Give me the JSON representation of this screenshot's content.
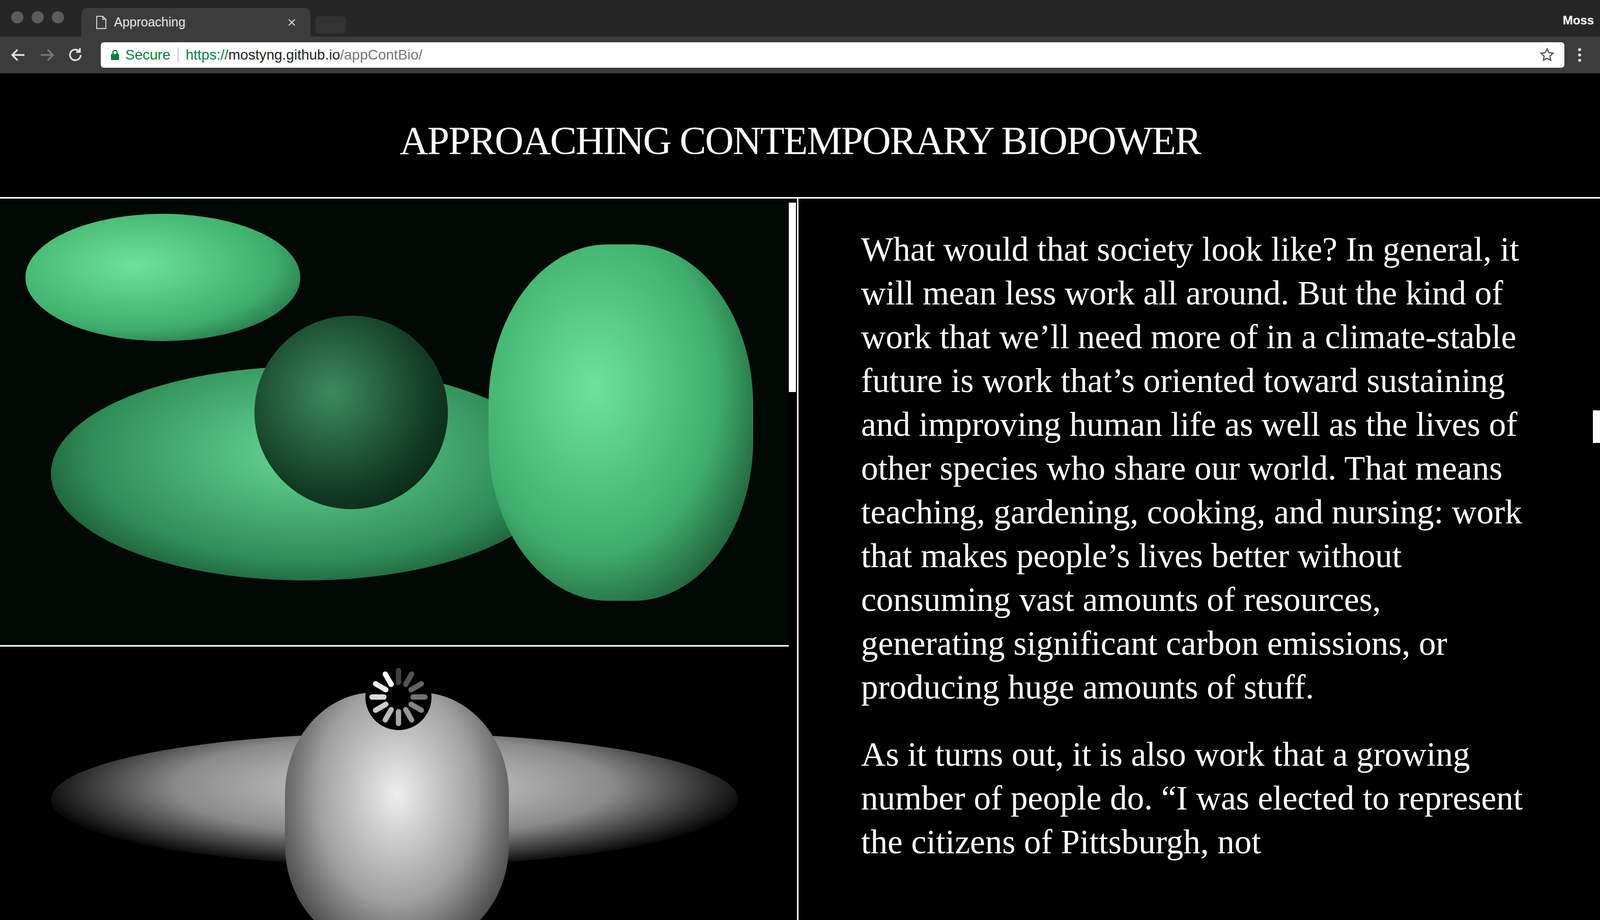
{
  "window": {
    "title": "Approaching",
    "user": "Moss"
  },
  "tabs": [
    {
      "label": "Approaching",
      "close": "×",
      "selected": true
    }
  ],
  "toolbar": {
    "secure": "Secure",
    "url_scheme": "https://",
    "url_host": "mostyng.github.io",
    "url_path": "/appContBio/",
    "forward_enabled": false
  },
  "page": {
    "title": "APPROACHING CONTEMPORARY BIOPOWER",
    "paragraphs": [
      "What would that society look like? In general, it will mean less work all around. But the kind of work that we’ll need more of in a climate-stable future is work that’s oriented toward sustaining and improving human life as well as the lives of other species who share our world. That means teaching, gardening, cooking, and nursing: work that makes people’s lives better without consuming vast amounts of resources, generating significant carbon emissions, or producing huge amounts of stuff.",
      "As it turns out, it is also work that a growing number of people do. “I was elected to represent the citizens of Pittsburgh, not"
    ]
  },
  "images": [
    {
      "loading": false
    },
    {
      "loading": true
    }
  ]
}
